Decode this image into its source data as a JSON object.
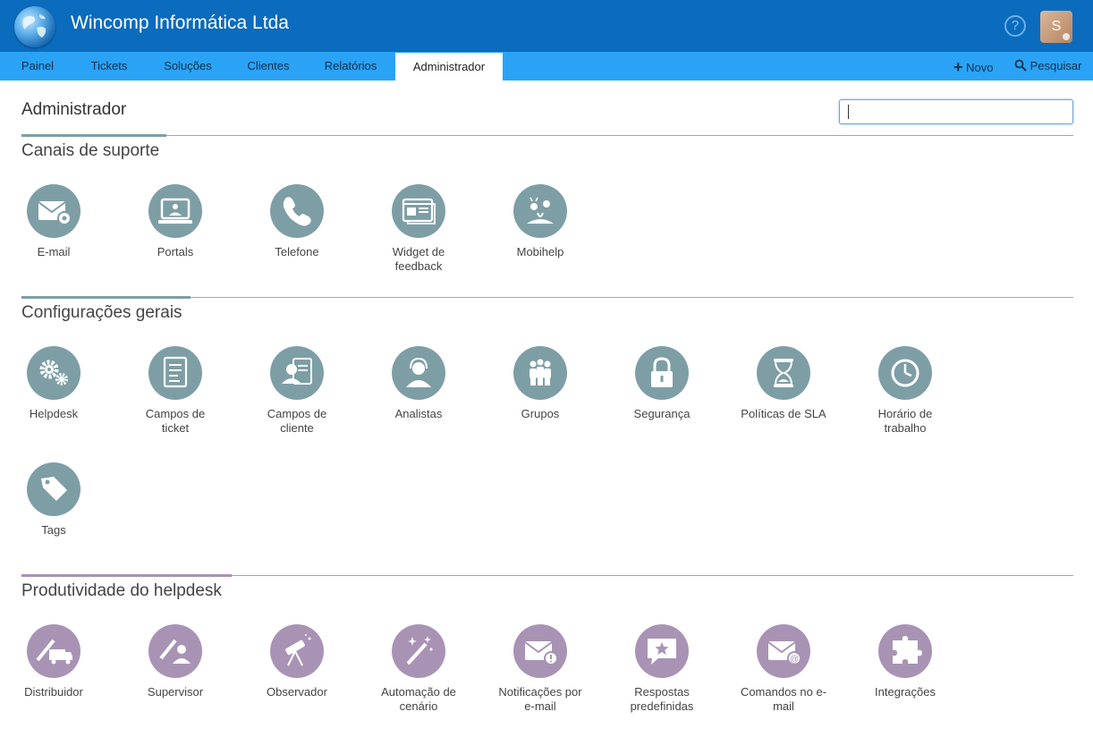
{
  "header": {
    "company": "Wincomp Informática Ltda",
    "help_icon": "help-circle-icon",
    "avatar_initial": "S"
  },
  "nav": {
    "tabs": [
      "Painel",
      "Tickets",
      "Soluções",
      "Clientes",
      "Relatórios",
      "Administrador"
    ],
    "active_tab": "Administrador",
    "new_label": "Novo",
    "search_label": "Pesquisar"
  },
  "page": {
    "title": "Administrador",
    "search_value": ""
  },
  "colors": {
    "topbar": "#0b6bbd",
    "navbar": "#2aa3f6",
    "teal_icon": "#7e9ea6",
    "purple_icon": "#a893b5",
    "teal_accent": "#7e9ea6",
    "purple_accent": "#a893b5"
  },
  "sections": [
    {
      "title": "Canais de suporte",
      "items": [
        {
          "label": "E-mail",
          "icon": "email-settings-icon"
        },
        {
          "label": "Portals",
          "icon": "portal-icon"
        },
        {
          "label": "Telefone",
          "icon": "phone-icon"
        },
        {
          "label": "Widget de feedback",
          "icon": "feedback-widget-icon"
        },
        {
          "label": "Mobihelp",
          "icon": "mobihelp-icon"
        }
      ]
    },
    {
      "title": "Configurações gerais",
      "items": [
        {
          "label": "Helpdesk",
          "icon": "gears-icon"
        },
        {
          "label": "Campos de ticket",
          "icon": "ticket-fields-icon"
        },
        {
          "label": "Campos de cliente",
          "icon": "customer-fields-icon"
        },
        {
          "label": "Analistas",
          "icon": "agent-headset-icon"
        },
        {
          "label": "Grupos",
          "icon": "groups-icon"
        },
        {
          "label": "Segurança",
          "icon": "lock-icon"
        },
        {
          "label": "Políticas de SLA",
          "icon": "hourglass-icon"
        },
        {
          "label": "Horário de trabalho",
          "icon": "clock-icon"
        },
        {
          "label": "Tags",
          "icon": "tag-icon"
        }
      ]
    },
    {
      "title": "Produtividade do helpdesk",
      "items": [
        {
          "label": "Distribuidor",
          "icon": "dispatcher-icon"
        },
        {
          "label": "Supervisor",
          "icon": "supervisor-icon"
        },
        {
          "label": "Observador",
          "icon": "telescope-icon"
        },
        {
          "label": "Automação de cenário",
          "icon": "magic-wand-icon"
        },
        {
          "label": "Notificações por e-mail",
          "icon": "email-notification-icon"
        },
        {
          "label": "Respostas predefinidas",
          "icon": "canned-response-icon"
        },
        {
          "label": "Comandos no e-mail",
          "icon": "email-commands-icon"
        },
        {
          "label": "Integrações",
          "icon": "puzzle-icon"
        }
      ]
    }
  ]
}
